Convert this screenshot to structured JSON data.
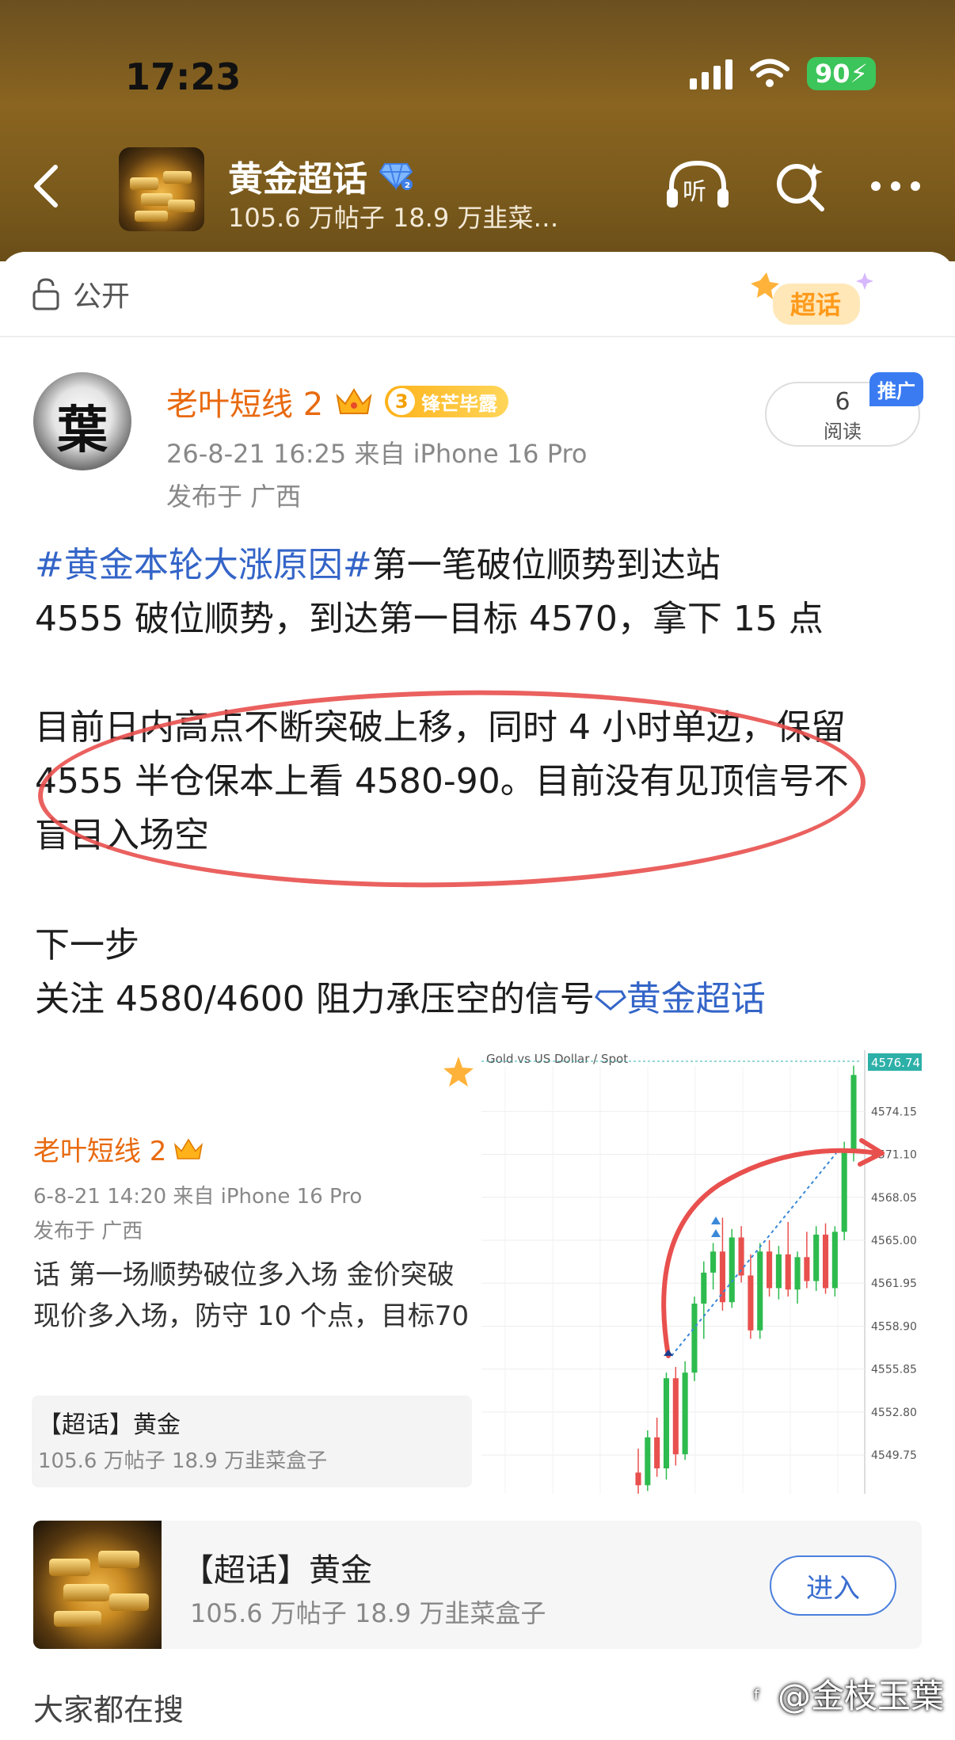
{
  "status": {
    "time": "17:23",
    "battery": "90"
  },
  "header": {
    "topic_name": "黄金超话",
    "topic_stats": "105.6 万帖子 18.9 万韭菜…",
    "icons": [
      "back-icon",
      "listen-icon",
      "search-icon",
      "more-icon"
    ],
    "listen_label": "听"
  },
  "visibility": {
    "label": "公开"
  },
  "super_badge": "超话",
  "post": {
    "author": "老叶短线 2",
    "rank_number": "3",
    "rank_title": "锋芒毕露",
    "meta": "26-8-21 16:25  来自 iPhone 16 Pro",
    "location": "发布于 广西",
    "read_count": "6",
    "read_label": "阅读",
    "promo_tag": "推广",
    "avatar_glyph": "葉",
    "hashtag": "#黄金本轮大涨原因#",
    "line1_rest": "第一笔破位顺势到达站",
    "line2": "4555 破位顺势，到达第一目标 4570，拿下 15 点",
    "para2_l1": "目前日内高点不断突破上移，同时 4 小时单边，保留",
    "para2_l2": "4555 半仓保本上看 4580-90。目前没有见顶信号不",
    "para2_l3": "盲目入场空",
    "para3_l1": "下一步",
    "para3_l2_text": "关注 4580/4600 阻力承压空的信号",
    "para3_topic": "黄金超话"
  },
  "embed": {
    "author": "老叶短线 2",
    "meta": "6-8-21 14:20  来自 iPhone 16 Pro",
    "location": "发布于 广西",
    "text_l1": "话  第一场顺势破位多入场 金价突破",
    "text_l2": "现价多入场，防守 10 个点，目标70",
    "card_title": "【超话】黄金",
    "card_sub": "105.6 万帖子 18.9 万韭菜盒子"
  },
  "chart_data": {
    "type": "candlestick",
    "title": "Gold vs US Dollar / Spot",
    "last_price": "4576.74",
    "ylim": [
      4547.0,
      4578.5
    ],
    "y_ticks": [
      "4574.15",
      "4571.10",
      "4568.05",
      "4565.00",
      "4561.95",
      "4558.90",
      "4555.85",
      "4552.80",
      "4549.75"
    ],
    "up_color": "#2dbb4e",
    "down_color": "#e8504e",
    "candles": [
      {
        "o": 4548.5,
        "h": 4550.2,
        "l": 4547.0,
        "c": 4547.6
      },
      {
        "o": 4547.6,
        "h": 4551.5,
        "l": 4547.2,
        "c": 4551.0
      },
      {
        "o": 4551.0,
        "h": 4552.4,
        "l": 4548.2,
        "c": 4548.8
      },
      {
        "o": 4548.8,
        "h": 4555.6,
        "l": 4548.0,
        "c": 4555.2
      },
      {
        "o": 4555.2,
        "h": 4556.0,
        "l": 4549.0,
        "c": 4549.8
      },
      {
        "o": 4549.8,
        "h": 4556.4,
        "l": 4549.4,
        "c": 4555.6
      },
      {
        "o": 4555.6,
        "h": 4561.0,
        "l": 4555.0,
        "c": 4560.5
      },
      {
        "o": 4560.5,
        "h": 4563.5,
        "l": 4558.0,
        "c": 4562.7
      },
      {
        "o": 4562.7,
        "h": 4564.8,
        "l": 4561.5,
        "c": 4564.2
      },
      {
        "o": 4564.2,
        "h": 4566.6,
        "l": 4560.0,
        "c": 4560.6
      },
      {
        "o": 4560.6,
        "h": 4565.8,
        "l": 4560.2,
        "c": 4565.2
      },
      {
        "o": 4565.2,
        "h": 4566.0,
        "l": 4562.0,
        "c": 4562.5
      },
      {
        "o": 4562.5,
        "h": 4564.0,
        "l": 4558.0,
        "c": 4558.6
      },
      {
        "o": 4558.6,
        "h": 4564.8,
        "l": 4558.0,
        "c": 4564.2
      },
      {
        "o": 4564.2,
        "h": 4565.0,
        "l": 4561.0,
        "c": 4561.6
      },
      {
        "o": 4561.6,
        "h": 4564.6,
        "l": 4560.8,
        "c": 4564.0
      },
      {
        "o": 4564.0,
        "h": 4566.3,
        "l": 4561.0,
        "c": 4561.5
      },
      {
        "o": 4561.5,
        "h": 4564.2,
        "l": 4560.5,
        "c": 4563.8
      },
      {
        "o": 4563.8,
        "h": 4565.6,
        "l": 4561.6,
        "c": 4562.1
      },
      {
        "o": 4562.1,
        "h": 4566.0,
        "l": 4561.4,
        "c": 4565.4
      },
      {
        "o": 4565.4,
        "h": 4566.2,
        "l": 4561.2,
        "c": 4561.6
      },
      {
        "o": 4561.6,
        "h": 4566.0,
        "l": 4561.0,
        "c": 4565.6
      },
      {
        "o": 4565.6,
        "h": 4572.0,
        "l": 4565.0,
        "c": 4571.4
      },
      {
        "o": 4571.4,
        "h": 4577.4,
        "l": 4570.6,
        "c": 4576.74
      }
    ]
  },
  "topic_card": {
    "title": "【超话】黄金",
    "sub": "105.6 万帖子 18.9 万韭菜盒子",
    "enter": "进入"
  },
  "search_section": {
    "title": "大家都在搜"
  },
  "watermark": "@金枝玉葉"
}
